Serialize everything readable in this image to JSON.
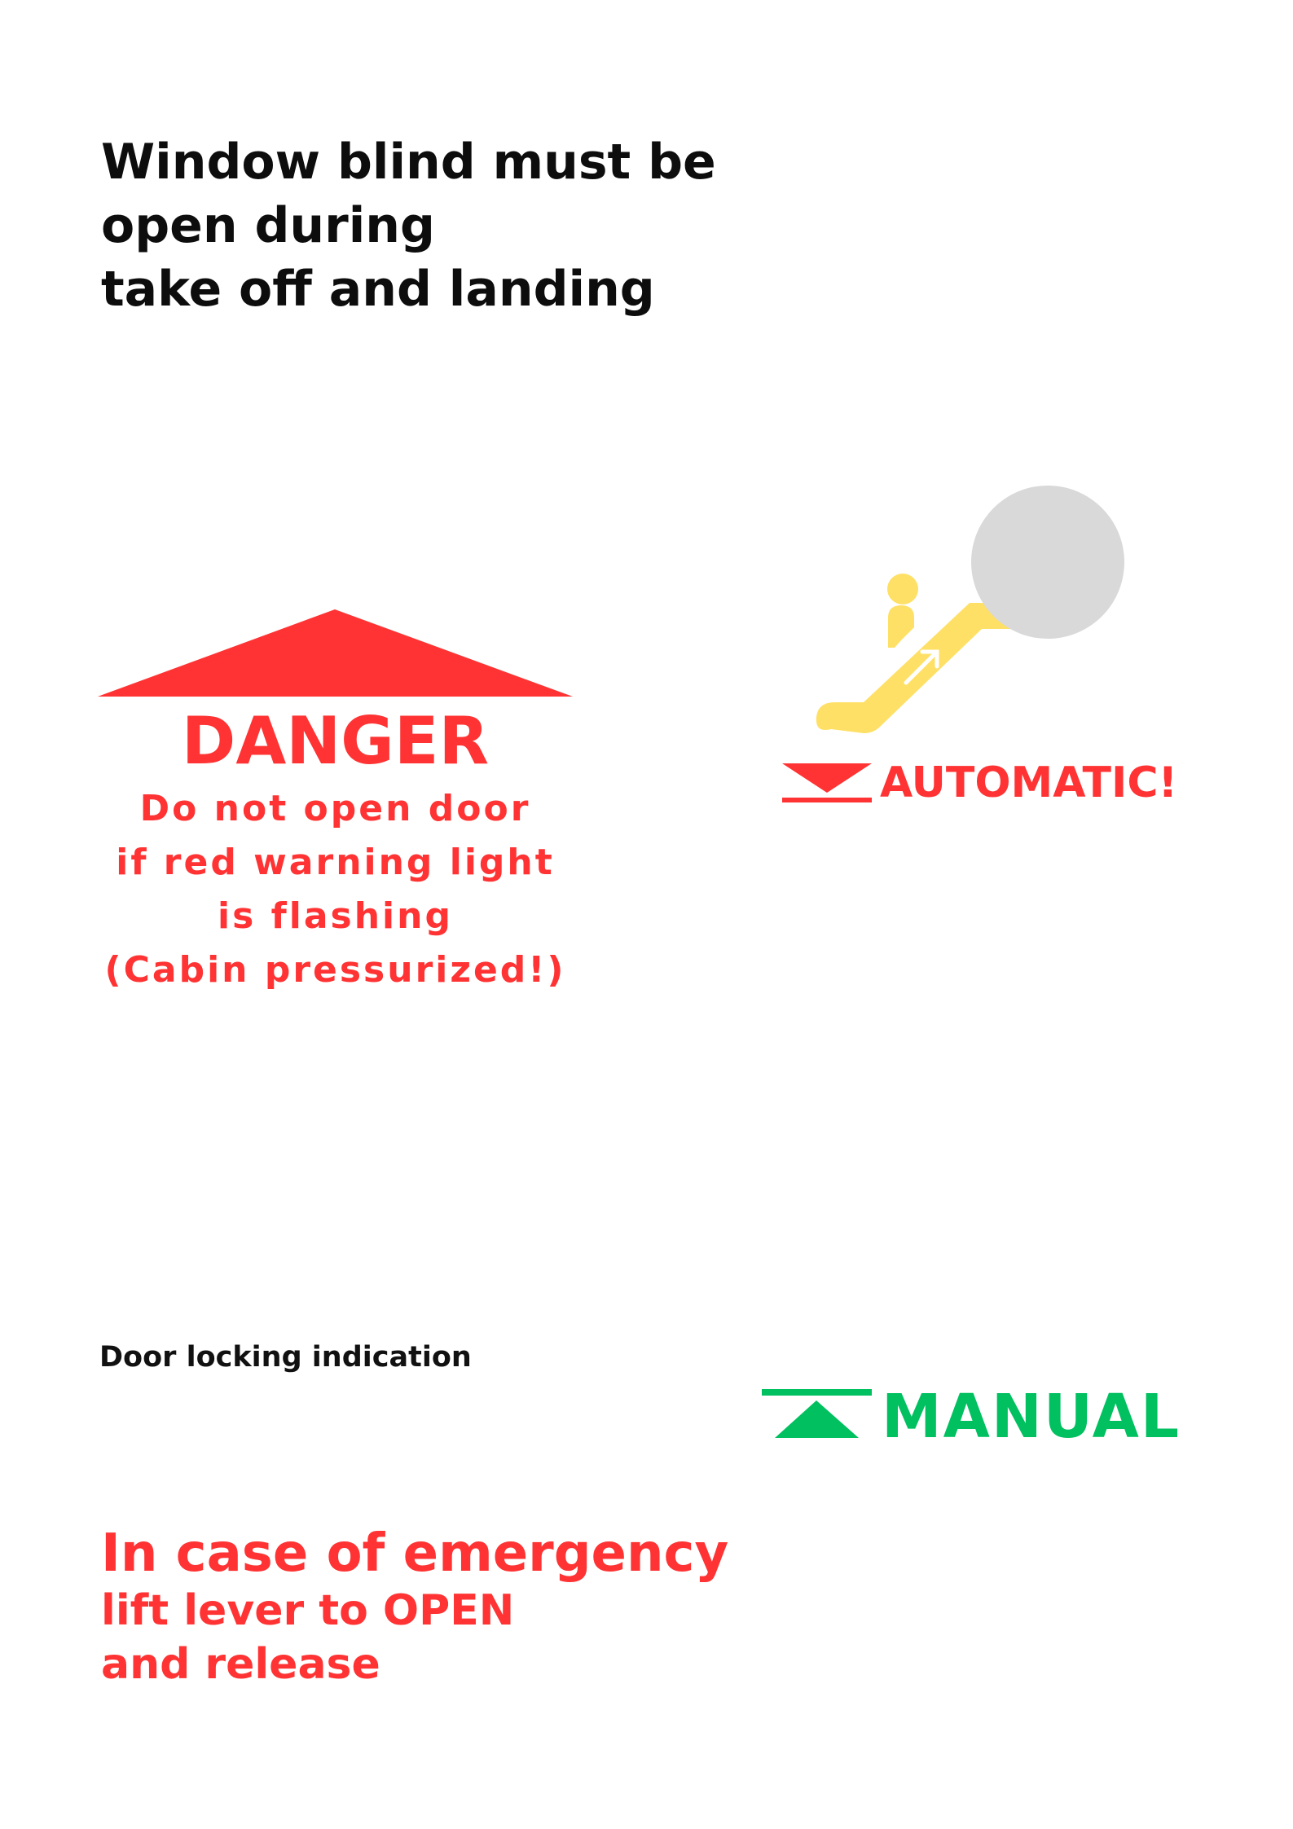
{
  "blind_notice": {
    "lines": [
      "Window blind must be",
      "open during",
      "take off and landing"
    ]
  },
  "danger_sign": {
    "title": "DANGER",
    "lines": [
      "Do not open door",
      "if red warning light",
      "is flashing",
      "(Cabin pressurized!)"
    ],
    "color": "#ff3333",
    "icon": "warning-triangle"
  },
  "escalator": {
    "icon": "escalator-icon",
    "accent": "#ffe066",
    "circle_color": "#d9d9d9"
  },
  "automatic_indicator": {
    "label": "AUTOMATIC!",
    "icon": "down-triangle-icon",
    "color": "#ff3333"
  },
  "door_locking": {
    "label": "Door locking indication"
  },
  "manual_indicator": {
    "label": "MANUAL",
    "icon": "up-triangle-icon",
    "color": "#00c060"
  },
  "emergency": {
    "heading": "In case of emergency",
    "lines": [
      "lift lever to OPEN",
      "and release"
    ],
    "color": "#ff3333"
  }
}
